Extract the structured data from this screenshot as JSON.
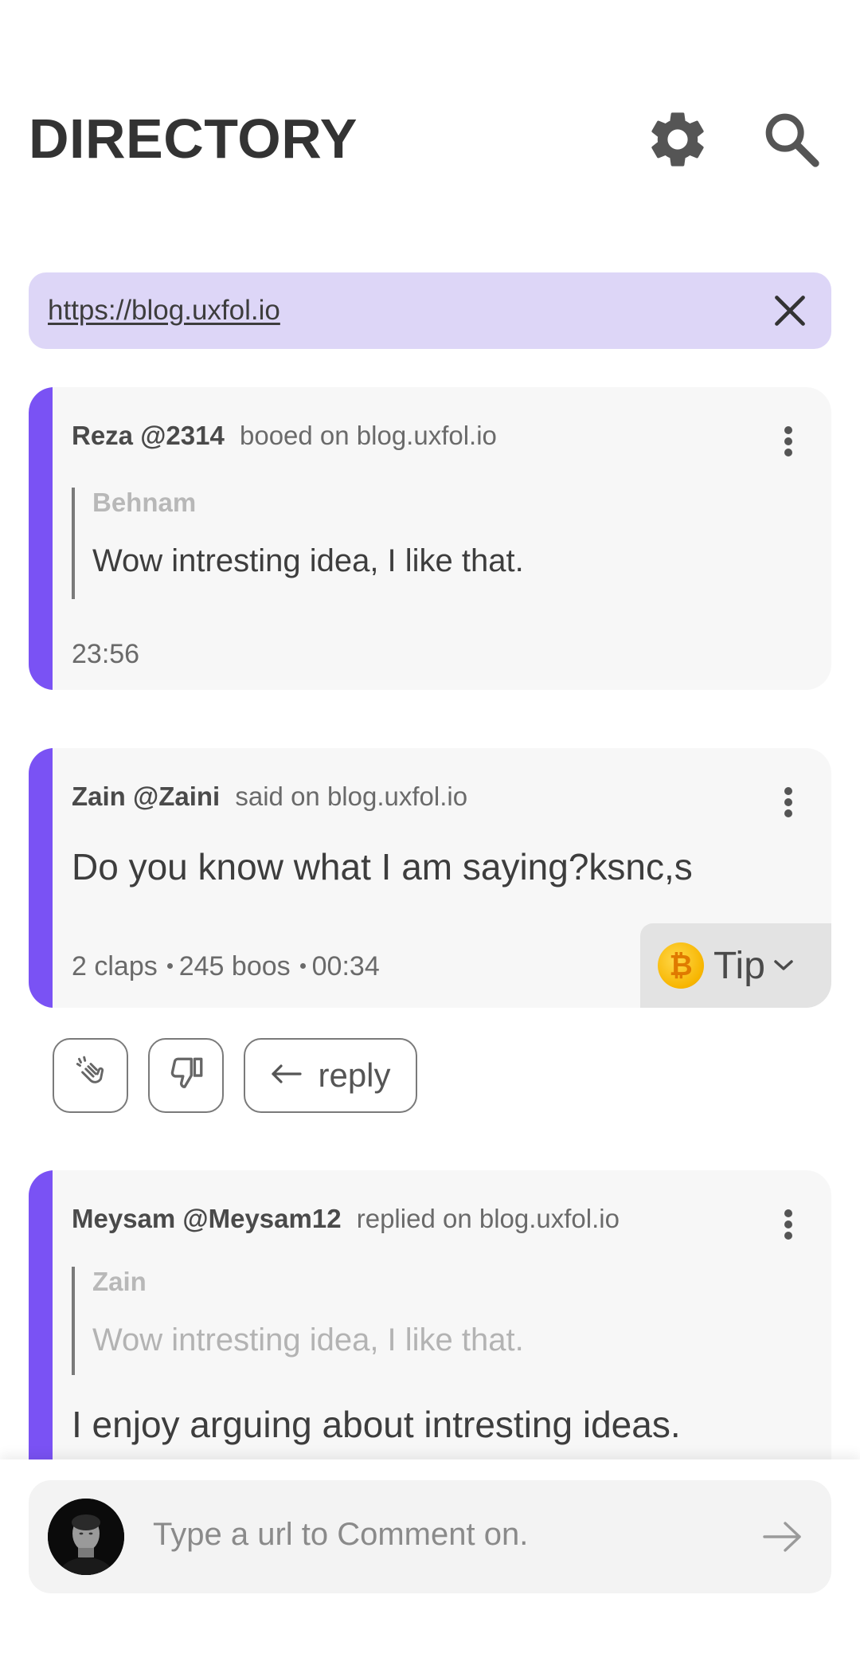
{
  "header": {
    "title": "DIRECTORY",
    "settings_icon": "gear-icon",
    "search_icon": "search-icon"
  },
  "url_filter": {
    "value": "https://blog.uxfol.io",
    "clear_icon": "close-icon"
  },
  "accent_color": "#7a52f4",
  "feed": [
    {
      "author": "Reza",
      "handle": "@2314",
      "action": "booed on blog.uxfol.io",
      "quote_author": "Behnam",
      "quote_text": "Wow intresting idea, I  like that.",
      "time": "23:56"
    },
    {
      "author": "Zain",
      "handle": "@Zaini",
      "action": "said on blog.uxfol.io",
      "text": "Do you know what I am saying?ksnc,s",
      "claps": "2 claps",
      "boos": "245 boos",
      "time": "00:34",
      "tip_label": "Tip",
      "tip_icon": "bitcoin-icon"
    },
    {
      "author": "Meysam",
      "handle": "@Meysam12",
      "action": "replied on blog.uxfol.io",
      "quote_author": "Zain",
      "quote_text": "Wow intresting idea, I  like that.",
      "text": "I enjoy arguing about intresting ideas."
    }
  ],
  "actions": {
    "clap_icon": "clap-icon",
    "boo_icon": "thumbs-down-icon",
    "reply_label": "reply"
  },
  "composer": {
    "placeholder": "Type a url to Comment on.",
    "send_icon": "arrow-right-icon"
  }
}
